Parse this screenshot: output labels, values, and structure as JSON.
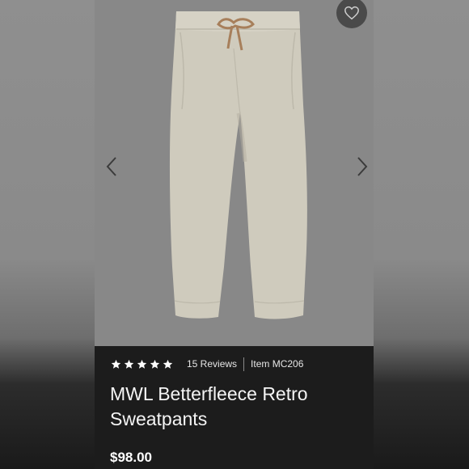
{
  "product": {
    "title": "MWL Betterfleece Retro Sweatpants",
    "price": "$98.00",
    "rating_stars": 5,
    "reviews_label": "15 Reviews",
    "item_label": "Item MC206"
  },
  "icons": {
    "favorite": "heart-icon",
    "previous": "chevron-left-icon",
    "next": "chevron-right-icon",
    "star": "star-icon"
  },
  "colors": {
    "info_background": "#1c1c1c",
    "image_background": "#888888",
    "garment": "#cfcbbd",
    "drawstring": "#a77f5b"
  }
}
